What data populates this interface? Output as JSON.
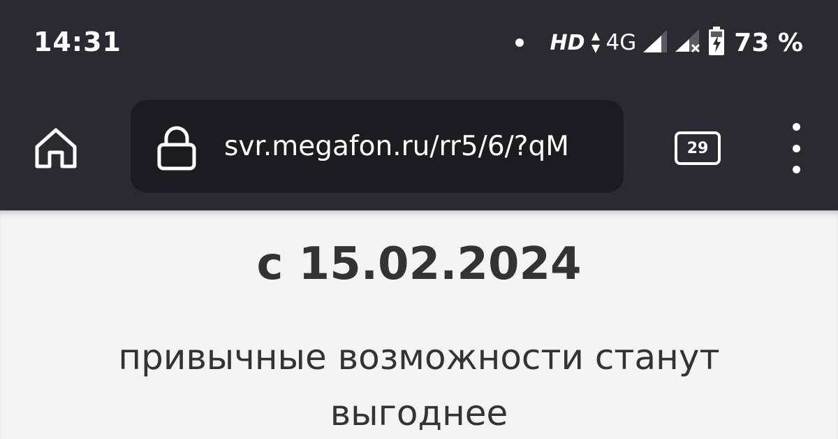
{
  "status_bar": {
    "time": "14:31",
    "hd": "HD",
    "network": "4G",
    "battery": "73 %"
  },
  "toolbar": {
    "url": "svr.megafon.ru/rr5/6/?qM",
    "tab_count": "29"
  },
  "content": {
    "date_heading": "с 15.02.2024",
    "subheading": "привычные возможности станут выгоднее"
  }
}
